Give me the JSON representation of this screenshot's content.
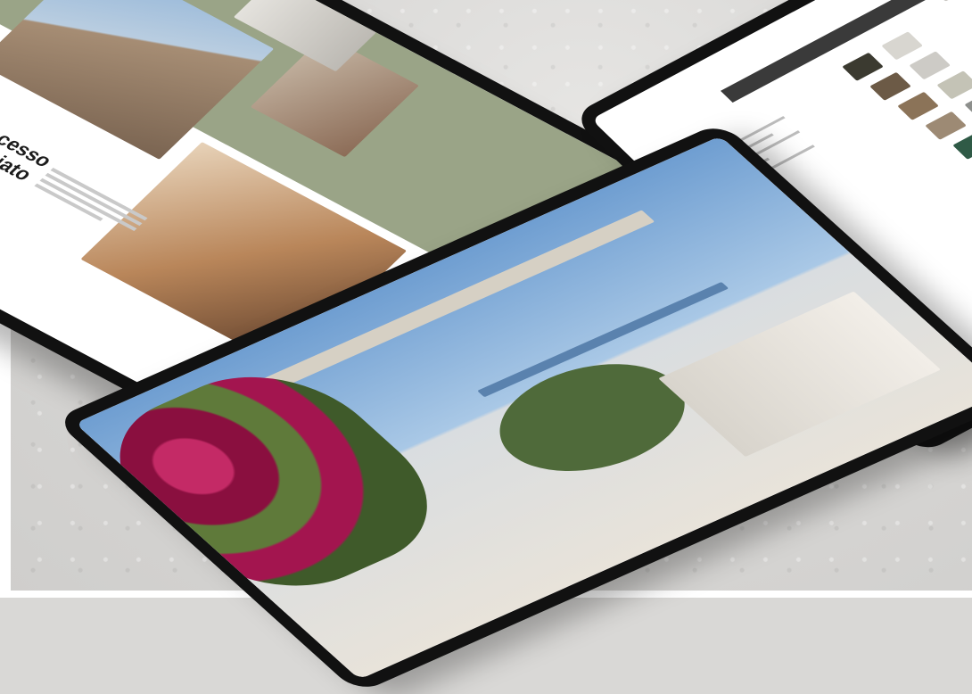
{
  "scene": {
    "description_tag": "",
    "background": "concrete"
  },
  "tablet_a": {
    "eyebrow": "",
    "headline": "Un accesso\nprivilegiato\nal tuo\nmondo",
    "nav_items": [
      "",
      "",
      ""
    ],
    "colors": {
      "sage": "#9aa487",
      "white": "#ffffff"
    }
  },
  "tablet_b": {
    "heading_text": "",
    "swatch_colors": [
      "#3b3a30",
      "#d8d6d0",
      "#6c5a46",
      "#cdcbc6",
      "#8b7358",
      "#c4c3b6",
      "#9d8a74",
      "#8d8f8c",
      "#2f5a46",
      "#4a4d49",
      "#cfc4aa",
      "#1b1b1b",
      "#6f8fa8"
    ]
  },
  "tablet_c": {
    "flower_color": "#a3154f",
    "sky_color": "#6f9ed1"
  }
}
